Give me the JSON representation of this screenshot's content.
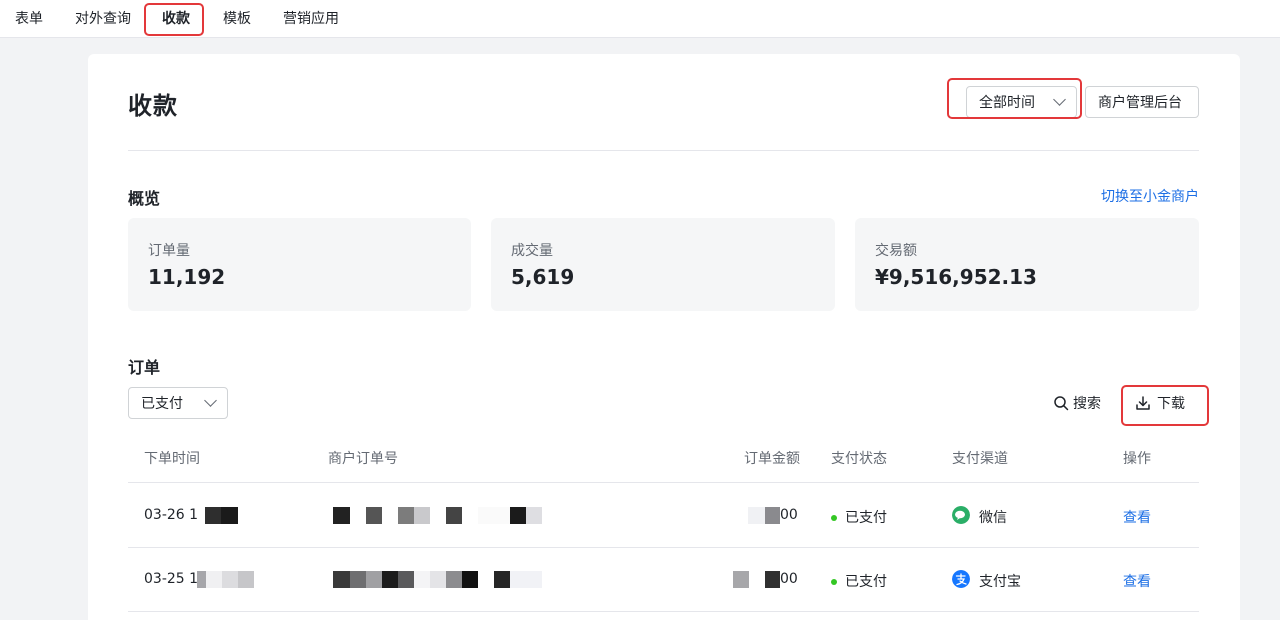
{
  "nav": {
    "items": [
      {
        "label": "表单"
      },
      {
        "label": "对外查询"
      },
      {
        "label": "收款"
      },
      {
        "label": "模板"
      },
      {
        "label": "营销应用"
      }
    ]
  },
  "header": {
    "title": "收款",
    "time_filter": {
      "selected": "全部时间"
    },
    "merchant_admin_button": "商户管理后台"
  },
  "overview": {
    "title": "概览",
    "switch_link": "切换至小金商户",
    "stats": [
      {
        "label": "订单量",
        "value": "11,192"
      },
      {
        "label": "成交量",
        "value": "5,619"
      },
      {
        "label": "交易额",
        "value": "¥9,516,952.13"
      }
    ]
  },
  "orders": {
    "title": "订单",
    "status_filter": {
      "selected": "已支付"
    },
    "search_label": "搜索",
    "download_label": "下载",
    "columns": [
      "下单时间",
      "商户订单号",
      "订单金额",
      "支付状态",
      "支付渠道",
      "操作"
    ],
    "rows": [
      {
        "time": "03-26 1",
        "amount_suffix": "00",
        "status": "已支付",
        "channel": "微信",
        "channel_icon": "wechat-icon",
        "action": "查看"
      },
      {
        "time": "03-25 1",
        "amount_suffix": "00",
        "status": "已支付",
        "channel": "支付宝",
        "channel_icon": "alipay-icon",
        "action": "查看"
      }
    ]
  },
  "colors": {
    "accent_link": "#1d6fe5",
    "highlight_box": "#e3383a",
    "paid_dot": "#34c724",
    "wechat": "#2aae67",
    "alipay": "#1677ff"
  }
}
